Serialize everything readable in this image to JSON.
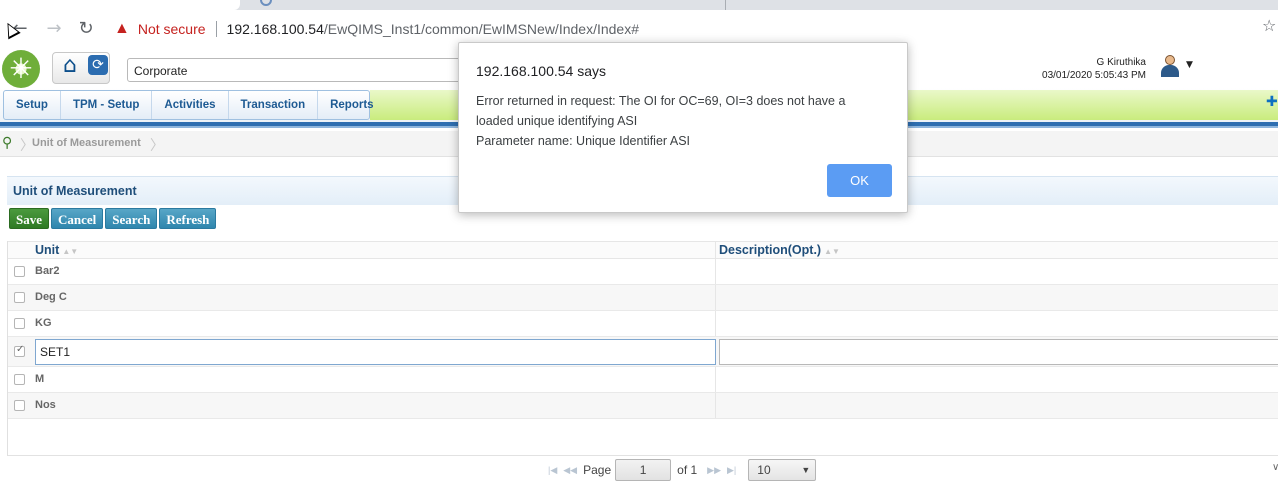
{
  "browser": {
    "security_label": "Not secure",
    "url_host": "192.168.100.54",
    "url_path": "/EwQIMS_Inst1/common/EwIMSNew/Index/Index#"
  },
  "header": {
    "organization": "Corporate",
    "user_name": "G Kiruthika",
    "user_datetime": "03/01/2020 5:05:43 PM"
  },
  "menu": {
    "items": [
      "Setup",
      "TPM - Setup",
      "Activities",
      "Transaction",
      "Reports"
    ]
  },
  "breadcrumb": {
    "current": "Unit of Measurement"
  },
  "panel": {
    "title": "Unit of Measurement",
    "buttons": {
      "save": "Save",
      "cancel": "Cancel",
      "search": "Search",
      "refresh": "Refresh"
    }
  },
  "grid": {
    "columns": {
      "unit": "Unit",
      "description": "Description(Opt.)"
    },
    "rows": [
      {
        "unit": "Bar2",
        "checked": false
      },
      {
        "unit": "Deg C",
        "checked": false
      },
      {
        "unit": "KG",
        "checked": false
      },
      {
        "unit": "SET1",
        "checked": true,
        "editing": true
      },
      {
        "unit": "M",
        "checked": false
      },
      {
        "unit": "Nos",
        "checked": false
      }
    ],
    "editing_value": "SET1"
  },
  "pager": {
    "page_label": "Page",
    "current_page": "1",
    "of_label": "of 1",
    "page_size": "10"
  },
  "dialog": {
    "title": "192.168.100.54 says",
    "message_line1": "Error returned in  request: The OI for OC=69, OI=3 does not have a",
    "message_line2": "loaded unique identifying ASI",
    "message_line3": "Parameter name: Unique Identifier ASI",
    "ok_label": "OK"
  }
}
